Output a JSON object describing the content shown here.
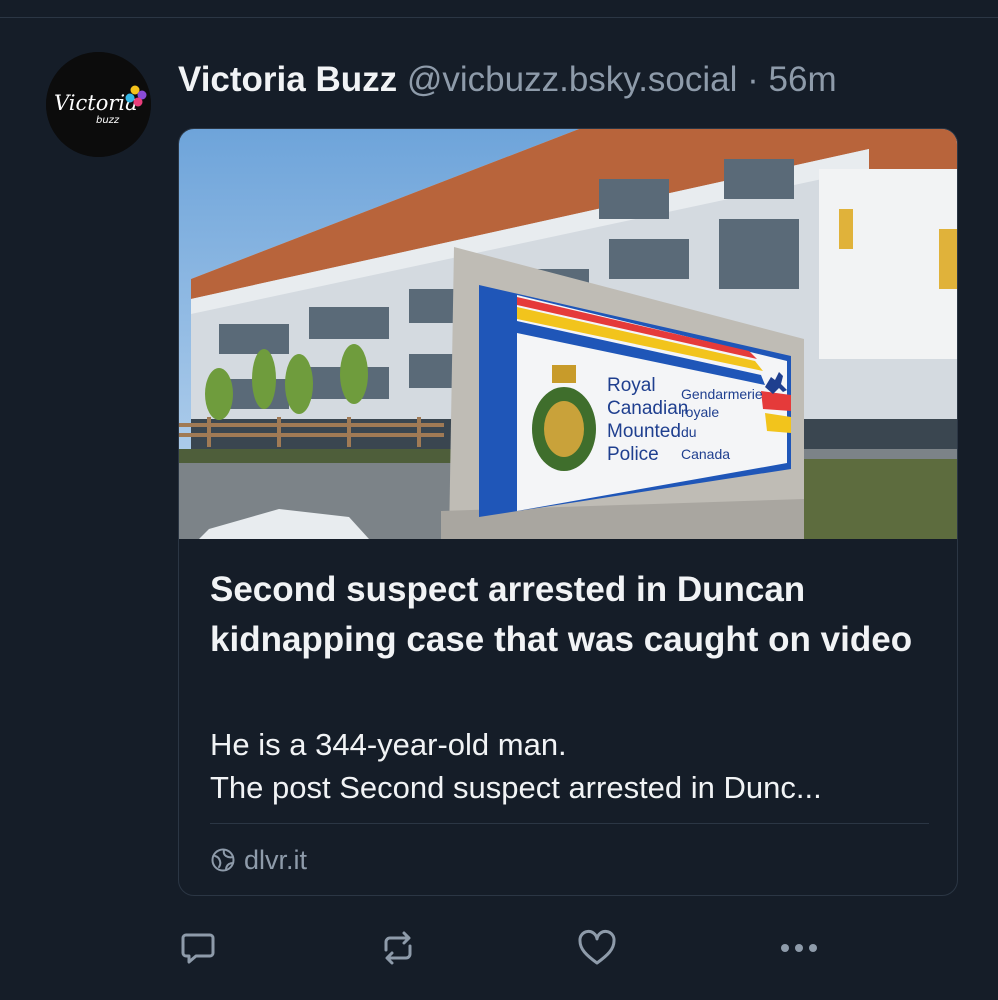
{
  "post": {
    "author_name": "Victoria Buzz",
    "author_handle": "@vicbuzz.bsky.social",
    "separator": "·",
    "timestamp": "56m",
    "avatar_text": "Victoria",
    "avatar_subtext": "buzz"
  },
  "link_card": {
    "title": "Second suspect arrested in Duncan kidnapping case that was caught on video",
    "description": "He is a 344-year-old man.\nThe post Second suspect arrested in Dunc...",
    "domain": "dlvr.it",
    "sign_lines_en": [
      "Royal",
      "Canadian",
      "Mounted",
      "Police"
    ],
    "sign_lines_fr": [
      "Gendarmerie",
      "royale",
      "du",
      "Canada"
    ]
  },
  "actions": [
    "reply-icon",
    "repost-icon",
    "like-icon",
    "more-icon"
  ],
  "colors": {
    "background": "#151d28",
    "border": "#2b3644",
    "muted_text": "#8e9baa",
    "text": "#f1f3f5"
  }
}
